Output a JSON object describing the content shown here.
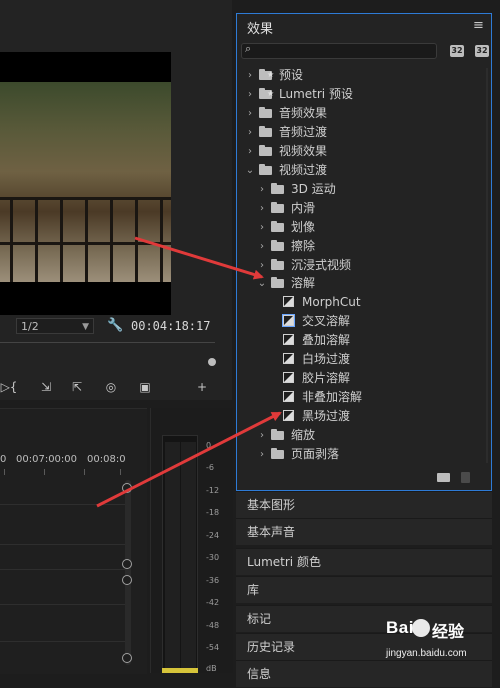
{
  "monitor": {
    "resolution": "1/2",
    "timecode": "00:04:18:17"
  },
  "toolbar": {
    "buttons": [
      "▷{",
      "⇲",
      "⇱",
      "◎",
      "▣",
      "+"
    ]
  },
  "timeline": {
    "times": [
      "0",
      "00:07:00:00",
      "00:08:0"
    ]
  },
  "meter": {
    "labels": [
      "0",
      "-6",
      "-12",
      "-18",
      "-24",
      "-30",
      "-36",
      "-42",
      "-48",
      "-54",
      "dB"
    ],
    "peak_color": "#d6c43a"
  },
  "effects_panel": {
    "title": "效果",
    "menu_icon": "hamburger-menu-icon",
    "search_placeholder": "",
    "header_buttons": [
      "32",
      "32"
    ],
    "tree": [
      {
        "label": "预设",
        "kind": "folder-star",
        "level": 0,
        "expanded": false
      },
      {
        "label": "Lumetri 预设",
        "kind": "folder-star",
        "level": 0,
        "expanded": false
      },
      {
        "label": "音频效果",
        "kind": "folder",
        "level": 0,
        "expanded": false
      },
      {
        "label": "音频过渡",
        "kind": "folder",
        "level": 0,
        "expanded": false
      },
      {
        "label": "视频效果",
        "kind": "folder",
        "level": 0,
        "expanded": false
      },
      {
        "label": "视频过渡",
        "kind": "folder",
        "level": 0,
        "expanded": true
      },
      {
        "label": "3D 运动",
        "kind": "folder",
        "level": 1,
        "expanded": false
      },
      {
        "label": "内滑",
        "kind": "folder",
        "level": 1,
        "expanded": false
      },
      {
        "label": "划像",
        "kind": "folder",
        "level": 1,
        "expanded": false
      },
      {
        "label": "擦除",
        "kind": "folder",
        "level": 1,
        "expanded": false
      },
      {
        "label": "沉浸式视频",
        "kind": "folder",
        "level": 1,
        "expanded": false
      },
      {
        "label": "溶解",
        "kind": "folder",
        "level": 1,
        "expanded": true
      },
      {
        "label": "MorphCut",
        "kind": "effect",
        "level": 2
      },
      {
        "label": "交叉溶解",
        "kind": "effect",
        "level": 2,
        "selected": true
      },
      {
        "label": "叠加溶解",
        "kind": "effect",
        "level": 2
      },
      {
        "label": "白场过渡",
        "kind": "effect",
        "level": 2
      },
      {
        "label": "胶片溶解",
        "kind": "effect",
        "level": 2
      },
      {
        "label": "非叠加溶解",
        "kind": "effect",
        "level": 2
      },
      {
        "label": "黑场过渡",
        "kind": "effect",
        "level": 2
      },
      {
        "label": "缩放",
        "kind": "folder",
        "level": 1,
        "expanded": false
      },
      {
        "label": "页面剥落",
        "kind": "folder",
        "level": 1,
        "expanded": false
      }
    ],
    "accent_color": "#2e7bd6"
  },
  "collapsed_panels": [
    "基本图形",
    "基本声音",
    "Lumetri 颜色",
    "库",
    "标记",
    "历史记录",
    "信息"
  ],
  "watermark": {
    "brand": "Bai",
    "suffix": "经验",
    "url": "jingyan.baidu.com"
  },
  "annotation_color": "#e03a3a"
}
